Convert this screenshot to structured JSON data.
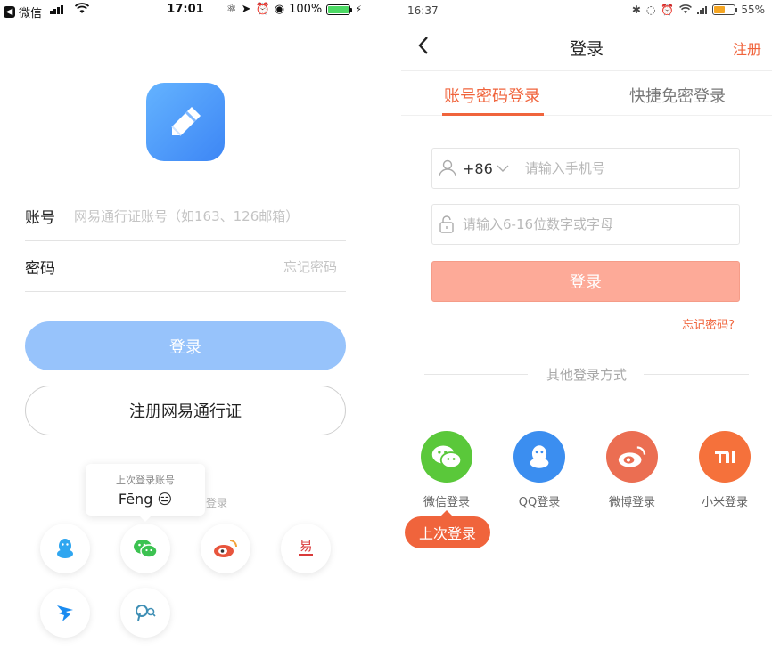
{
  "left": {
    "status_bar": {
      "back_app": "微信",
      "time": "17:01",
      "battery": "100%",
      "battery_level": 1.0
    },
    "account_label": "账号",
    "account_placeholder": "网易通行证账号（如163、126邮箱）",
    "password_label": "密码",
    "forgot_password": "忘记密码",
    "login_button": "登录",
    "register_button": "注册网易通行证",
    "other_login_partial": "登录",
    "tooltip": {
      "title": "上次登录账号",
      "name": "Fēng",
      "emoji": "😑"
    },
    "social_icons": [
      "qq-icon",
      "wechat-icon",
      "weibo-icon",
      "yixin-icon",
      "dingtalk-icon",
      "search-magnifier-icon"
    ]
  },
  "right": {
    "status_bar": {
      "time": "16:37",
      "battery": "55%",
      "battery_level": 0.55
    },
    "nav": {
      "title": "登录",
      "register": "注册"
    },
    "tabs": [
      {
        "label": "账号密码登录",
        "active": true
      },
      {
        "label": "快捷免密登录",
        "active": false
      }
    ],
    "phone": {
      "country_code": "+86",
      "placeholder": "请输入手机号"
    },
    "password": {
      "placeholder": "请输入6-16位数字或字母"
    },
    "login_button": "登录",
    "forgot_password": "忘记密码?",
    "other_methods_label": "其他登录方式",
    "social": [
      {
        "label": "微信登录",
        "icon": "wechat-icon",
        "color": "#5ac83a"
      },
      {
        "label": "QQ登录",
        "icon": "qq-icon",
        "color": "#3b8ef0"
      },
      {
        "label": "微博登录",
        "icon": "weibo-icon",
        "color": "#eb6e52"
      },
      {
        "label": "小米登录",
        "icon": "xiaomi-icon",
        "color": "#f5713b"
      }
    ],
    "last_login_badge": "上次登录",
    "accent_color": "#f0643c"
  }
}
